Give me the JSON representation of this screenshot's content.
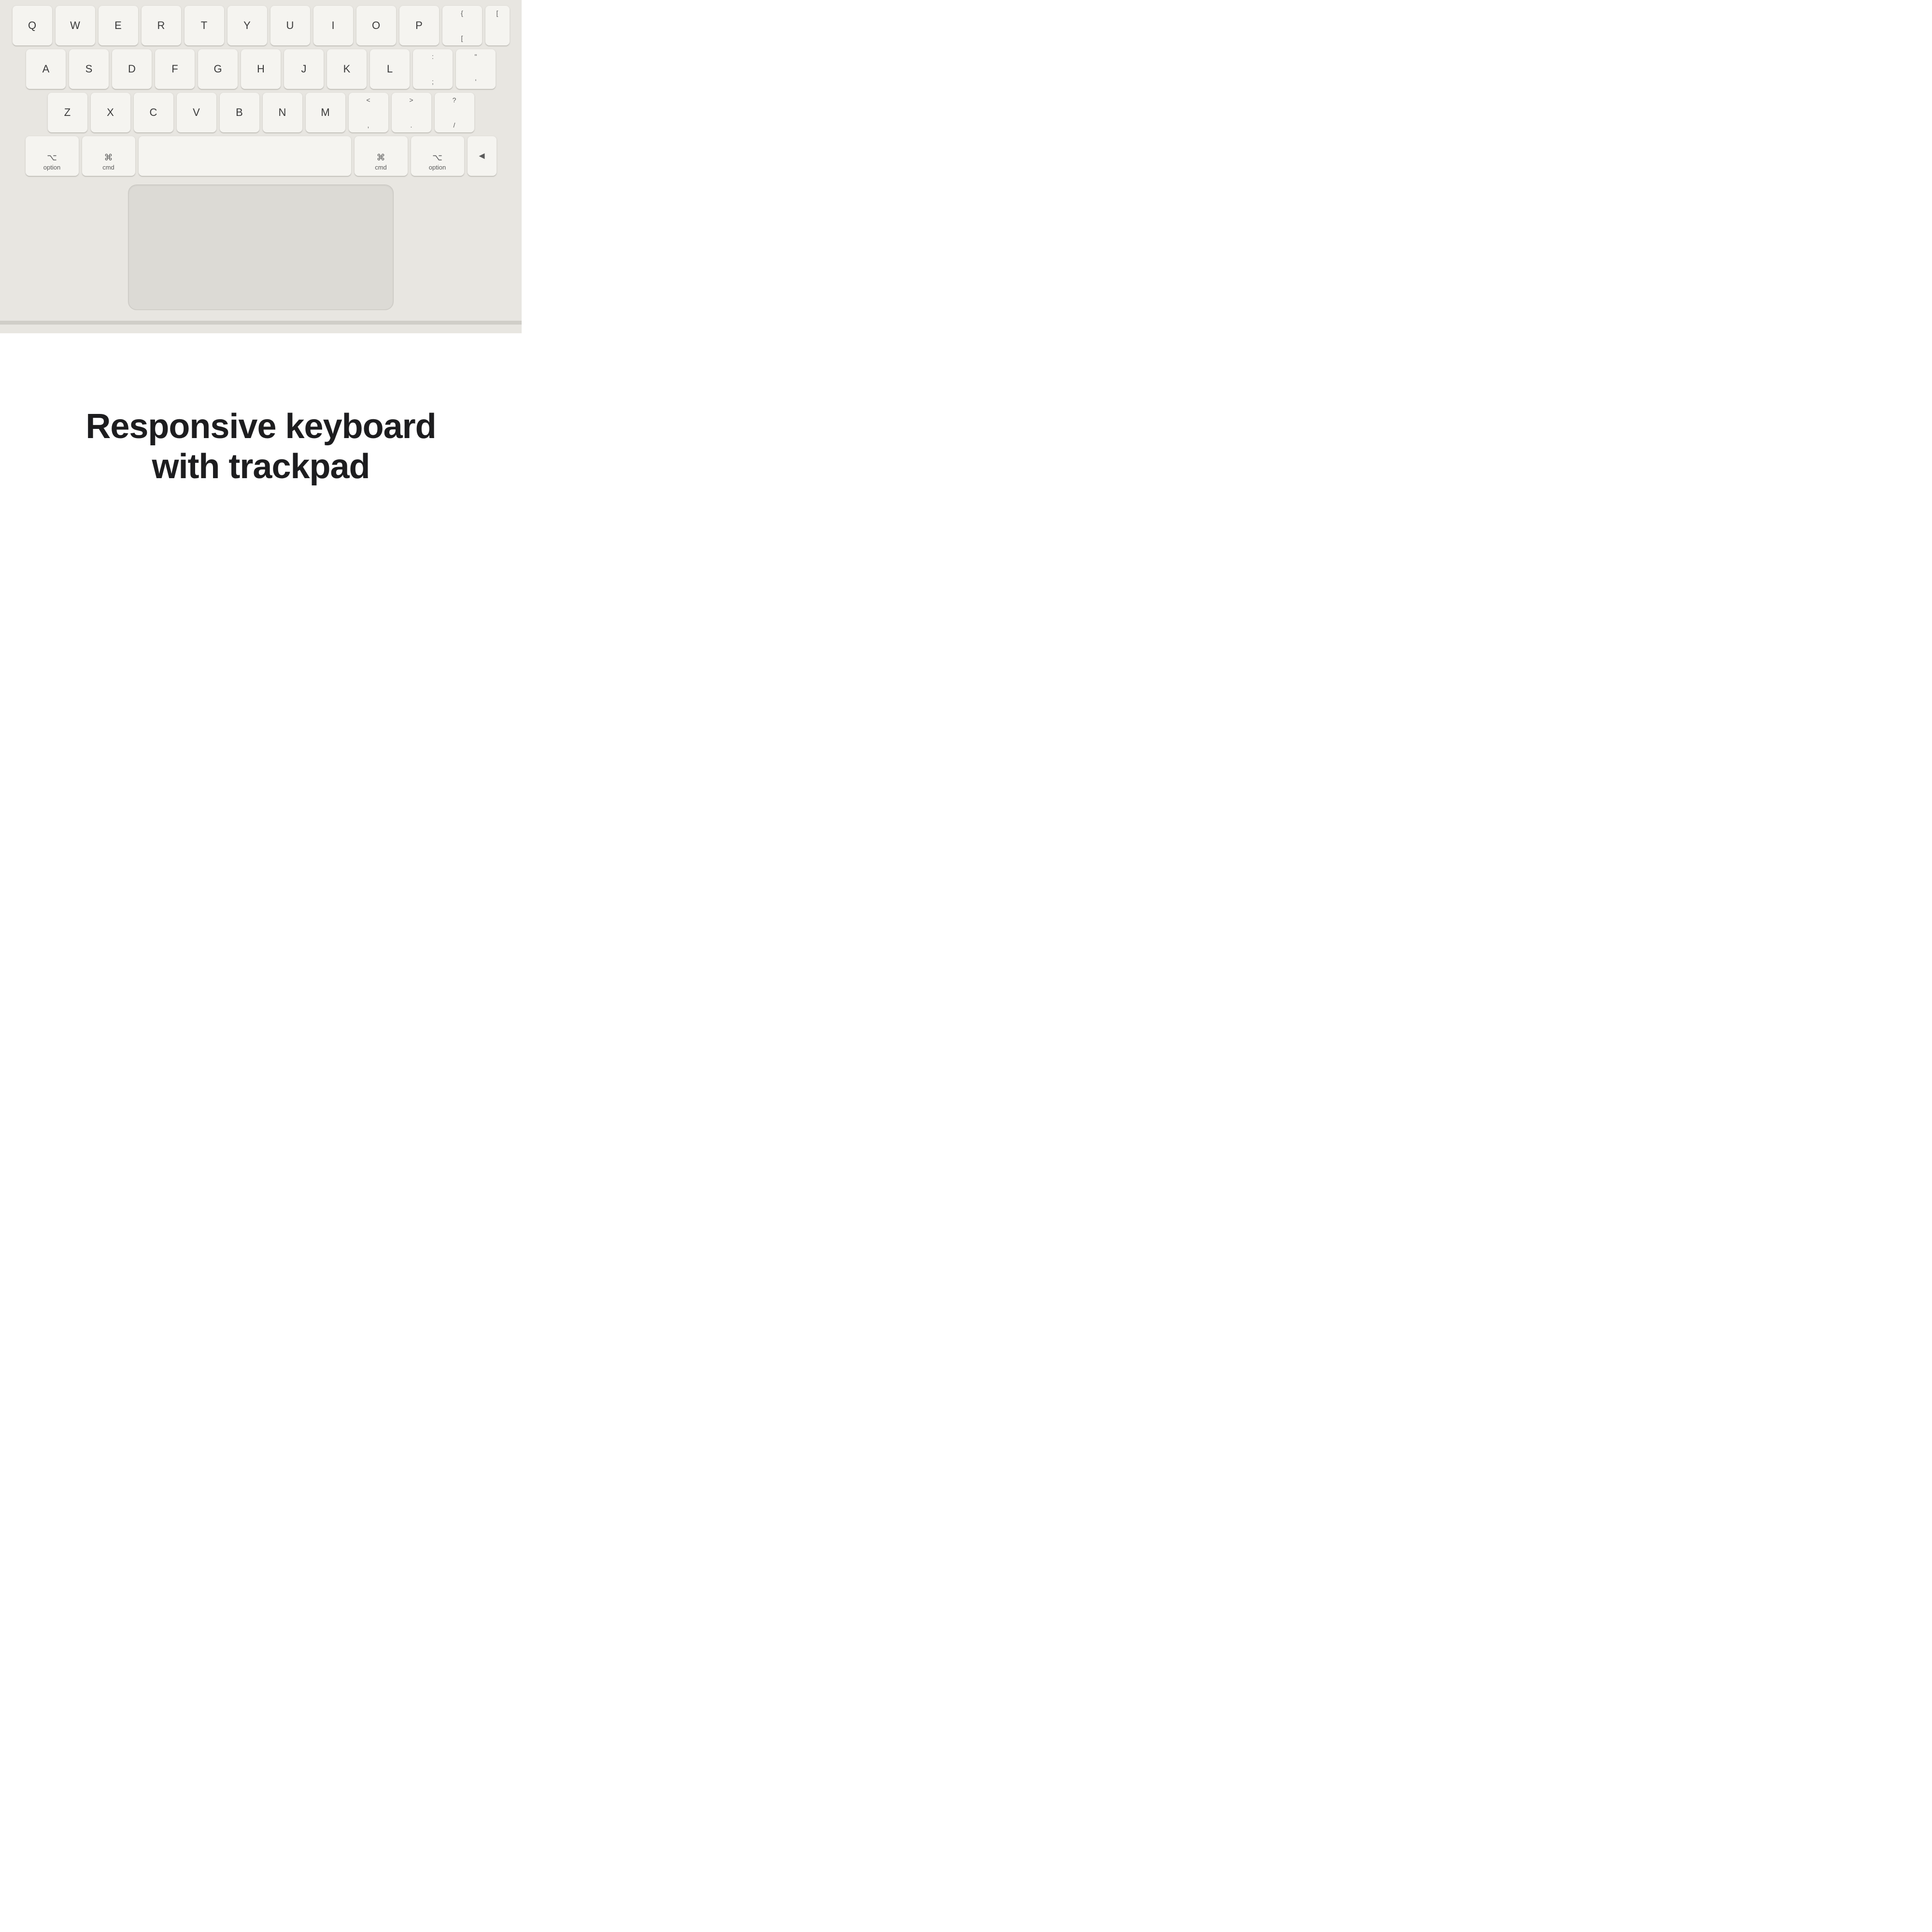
{
  "keyboard": {
    "rows": [
      {
        "id": "row1",
        "keys": [
          {
            "id": "q",
            "label": "Q"
          },
          {
            "id": "w",
            "label": "W"
          },
          {
            "id": "e",
            "label": "E"
          },
          {
            "id": "r",
            "label": "R"
          },
          {
            "id": "t",
            "label": "T"
          },
          {
            "id": "y",
            "label": "Y"
          },
          {
            "id": "u",
            "label": "U"
          },
          {
            "id": "i",
            "label": "I"
          },
          {
            "id": "o",
            "label": "O"
          },
          {
            "id": "p",
            "label": "P"
          },
          {
            "id": "bracket",
            "top": "{",
            "bottom": "["
          },
          {
            "id": "rbracket",
            "top": "[",
            "bottom": "["
          }
        ]
      },
      {
        "id": "row2",
        "keys": [
          {
            "id": "a",
            "label": "A"
          },
          {
            "id": "s",
            "label": "S"
          },
          {
            "id": "d",
            "label": "D"
          },
          {
            "id": "f",
            "label": "F"
          },
          {
            "id": "g",
            "label": "G"
          },
          {
            "id": "h",
            "label": "H"
          },
          {
            "id": "j",
            "label": "J"
          },
          {
            "id": "k",
            "label": "K"
          },
          {
            "id": "l",
            "label": "L"
          },
          {
            "id": "semi",
            "top": ":",
            "bottom": ";"
          },
          {
            "id": "quote",
            "top": "\"",
            "bottom": "'"
          }
        ]
      },
      {
        "id": "row3",
        "keys": [
          {
            "id": "z",
            "label": "Z"
          },
          {
            "id": "x",
            "label": "X"
          },
          {
            "id": "c",
            "label": "C"
          },
          {
            "id": "v",
            "label": "V"
          },
          {
            "id": "b",
            "label": "B"
          },
          {
            "id": "n",
            "label": "N"
          },
          {
            "id": "m",
            "label": "M"
          },
          {
            "id": "comma",
            "top": "<",
            "bottom": ","
          },
          {
            "id": "period",
            "top": ">",
            "bottom": "."
          },
          {
            "id": "slash",
            "top": "?",
            "bottom": "/"
          }
        ]
      },
      {
        "id": "row4",
        "keys": [
          {
            "id": "opt-l",
            "symbol": "⌥",
            "label": "option",
            "type": "modifier"
          },
          {
            "id": "cmd-l",
            "symbol": "⌘",
            "label": "cmd",
            "type": "modifier"
          },
          {
            "id": "space",
            "label": "",
            "type": "space"
          },
          {
            "id": "cmd-r",
            "symbol": "⌘",
            "label": "cmd",
            "type": "modifier"
          },
          {
            "id": "opt-r",
            "symbol": "⌥",
            "label": "option",
            "type": "modifier"
          },
          {
            "id": "arrow-l",
            "label": "◄",
            "type": "arrow"
          }
        ]
      }
    ],
    "trackpad": {
      "aria": "trackpad"
    }
  },
  "caption": {
    "line1": "Responsive keyboard",
    "line2": "with trackpad"
  }
}
